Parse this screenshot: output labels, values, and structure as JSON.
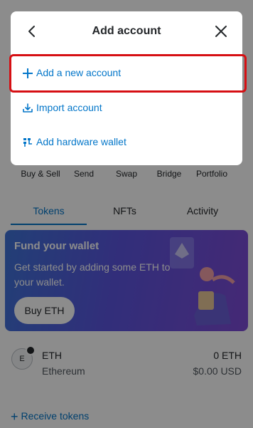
{
  "actions": [
    {
      "label": "Buy & Sell"
    },
    {
      "label": "Send"
    },
    {
      "label": "Swap"
    },
    {
      "label": "Bridge"
    },
    {
      "label": "Portfolio"
    }
  ],
  "tabs": [
    {
      "label": "Tokens",
      "active": true
    },
    {
      "label": "NFTs"
    },
    {
      "label": "Activity"
    }
  ],
  "banner": {
    "title": "Fund your wallet",
    "description": "Get started by adding some ETH to your wallet.",
    "button_label": "Buy ETH"
  },
  "asset": {
    "icon_letter": "E",
    "symbol": "ETH",
    "name": "Ethereum",
    "balance": "0 ETH",
    "fiat": "$0.00 USD"
  },
  "receive_label": "Receive tokens",
  "modal": {
    "title": "Add account",
    "items": [
      {
        "label": "Add a new account",
        "icon": "plus-icon"
      },
      {
        "label": "Import account",
        "icon": "import-icon"
      },
      {
        "label": "Add hardware wallet",
        "icon": "hardware-wallet-icon"
      }
    ]
  },
  "colors": {
    "accent": "#0376c9",
    "highlight": "#d60f13",
    "text": "#24272a"
  }
}
